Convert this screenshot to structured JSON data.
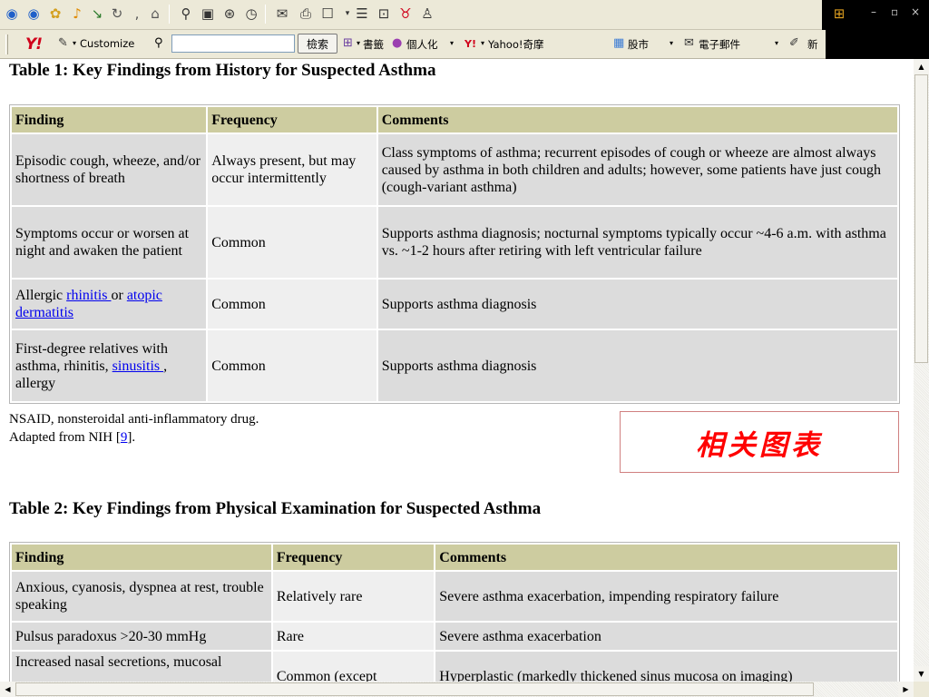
{
  "browser": {
    "search_label": "檢索",
    "customize_label": "Customize",
    "toolbar_links": [
      "書籤",
      "個人化",
      "Yahoo!奇摩",
      "股市",
      "電子郵件",
      "新"
    ],
    "window_controls": [
      "–",
      "▫",
      "×"
    ]
  },
  "table1": {
    "title": "Table 1: Key Findings from History for Suspected Asthma",
    "headers": [
      "Finding",
      "Frequency",
      "Comments"
    ],
    "rows": [
      {
        "finding": "Episodic cough, wheeze, and/or shortness of breath",
        "frequency": "Always present, but may occur intermittently",
        "comment": "Class symptoms of asthma; recurrent episodes of cough or wheeze are almost always caused by asthma in both children and adults; however, some patients have just cough (cough-variant asthma)"
      },
      {
        "finding": "Symptoms occur or worsen at night and awaken the patient",
        "frequency": "Common",
        "comment": "Supports asthma diagnosis; nocturnal symptoms typically occur ~4-6 a.m. with asthma vs. ~1-2 hours after retiring with left ventricular failure"
      },
      {
        "finding_prefix": "Allergic ",
        "finding_link1": "rhinitis ",
        "finding_mid": "or ",
        "finding_link2": "atopic dermatitis",
        "frequency": "Common",
        "comment": "Supports asthma diagnosis"
      },
      {
        "finding_prefix": "First-degree relatives with asthma, rhinitis, ",
        "finding_link1": "sinusitis ",
        "finding_suffix": ", allergy",
        "frequency": "Common",
        "comment": "Supports asthma diagnosis"
      }
    ],
    "footnote": "NSAID, nonsteroidal anti-inflammatory drug.",
    "adapted_prefix": "Adapted from NIH [",
    "adapted_ref": "9",
    "adapted_suffix": "]."
  },
  "related_charts_label": "相关图表",
  "table2": {
    "title": "Table 2: Key Findings from Physical Examination for Suspected Asthma",
    "headers": [
      "Finding",
      "Frequency",
      "Comments"
    ],
    "rows": [
      {
        "finding": "Anxious, cyanosis, dyspnea at rest, trouble speaking",
        "frequency": "Relatively rare",
        "comment": "Severe asthma exacerbation, impending respiratory failure"
      },
      {
        "finding": "Pulsus paradoxus >20-30 mmHg",
        "frequency": "Rare",
        "comment": "Severe asthma exacerbation"
      },
      {
        "finding": "Increased nasal secretions, mucosal",
        "frequency": "Common (except",
        "comment": "Hyperplastic (markedly thickened sinus mucosa on imaging)"
      }
    ]
  }
}
